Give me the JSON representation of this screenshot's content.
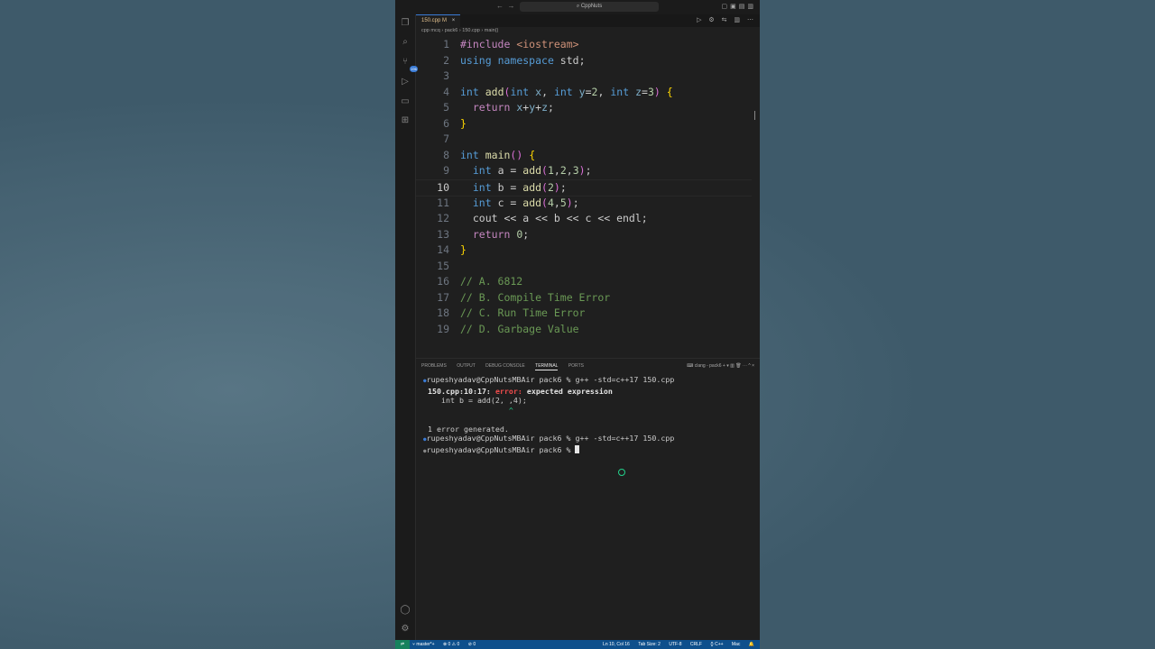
{
  "window": {
    "command_center": "CppNuts",
    "tab": {
      "label": "150.cpp",
      "modified": "M"
    },
    "breadcrumb": [
      "cpp mcq",
      "pack6",
      "150.cpp",
      "main()"
    ]
  },
  "editor": {
    "current_line": 10,
    "lines": [
      "#include <iostream>",
      "using namespace std;",
      "",
      "int add(int x, int y=2, int z=3) {",
      "  return x+y+z;",
      "}",
      "",
      "int main() {",
      "  int a = add(1,2,3);",
      "  int b = add(2);",
      "  int c = add(4,5);",
      "  cout << a << b << c << endl;",
      "  return 0;",
      "}",
      "",
      "// A. 6812",
      "// B. Compile Time Error",
      "// C. Run Time Error",
      "// D. Garbage Value"
    ]
  },
  "panel": {
    "tabs": [
      "PROBLEMS",
      "OUTPUT",
      "DEBUG CONSOLE",
      "TERMINAL",
      "PORTS"
    ],
    "active_tab": "TERMINAL",
    "terminal_name": "clang - pack6",
    "terminal": {
      "prompt": "rupeshyadav@CppNutsMBAir pack6 %",
      "cmd1": "g++ -std=c++17 150.cpp",
      "err_loc": "150.cpp:10:17:",
      "err_word": "error:",
      "err_msg": "expected expression",
      "src_line": "    int b = add(2, ,4);",
      "caret_line": "                   ^",
      "generated": "1 error generated.",
      "cmd2": "g++ -std=c++17 150.cpp"
    }
  },
  "statusbar": {
    "branch": "master*+",
    "problems": "⊗ 0 ⚠ 0",
    "ports": "0",
    "position": "Ln 10, Col 16",
    "tab_size": "Tab Size: 2",
    "encoding": "UTF-8",
    "eol": "CRLF",
    "language": "C++",
    "platform": "Mac"
  },
  "colors": {
    "keyword": "#569cd6",
    "comment": "#6a9955",
    "string": "#ce9178",
    "number": "#b5cea8",
    "statusbar": "#0e4f8c",
    "error": "#f14c4c"
  }
}
